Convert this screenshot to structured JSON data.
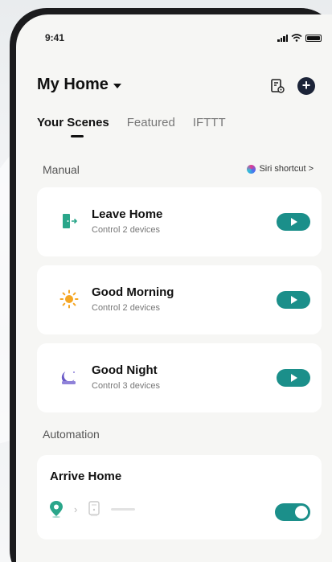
{
  "status": {
    "time": "9:41"
  },
  "header": {
    "title": "My Home"
  },
  "tabs": [
    {
      "label": "Your Scenes",
      "active": true
    },
    {
      "label": "Featured",
      "active": false
    },
    {
      "label": "IFTTT",
      "active": false
    }
  ],
  "manual": {
    "label": "Manual",
    "siri_label": "Siri shortcut >",
    "scenes": [
      {
        "name": "Leave Home",
        "sub": "Control 2 devices",
        "icon": "door-exit-icon"
      },
      {
        "name": "Good Morning",
        "sub": "Control 2 devices",
        "icon": "sun-icon"
      },
      {
        "name": "Good Night",
        "sub": "Control 3 devices",
        "icon": "moon-icon"
      }
    ]
  },
  "automation": {
    "label": "Automation",
    "items": [
      {
        "name": "Arrive Home",
        "enabled": true
      }
    ]
  },
  "colors": {
    "accent": "#1b8f8a",
    "add_button": "#1c2438",
    "background": "#f6f6f4"
  }
}
